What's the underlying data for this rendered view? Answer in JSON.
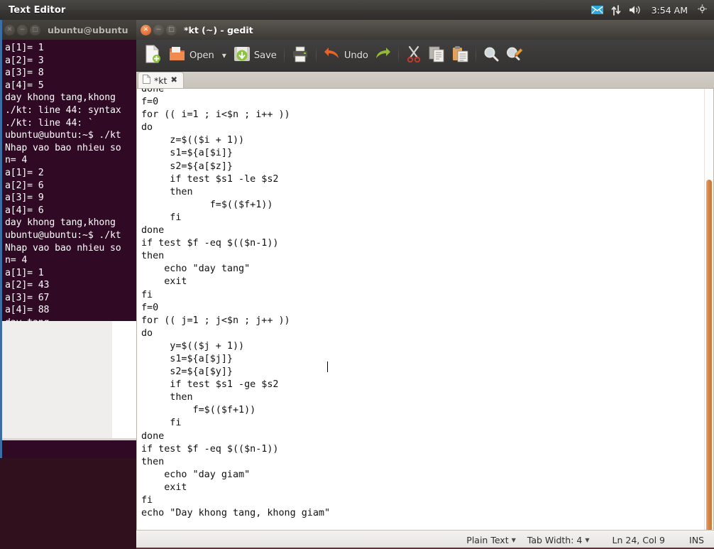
{
  "panel": {
    "title": "Text Editor",
    "clock": "3:54 AM",
    "icons": [
      "mail-icon",
      "network-icon",
      "volume-icon",
      "session-cog-icon"
    ]
  },
  "terminal_window": {
    "title": "ubuntu@ubuntu",
    "buttons": [
      "close",
      "minimize",
      "maximize"
    ],
    "content": "a[1]= 1\na[2]= 3\na[3]= 8\na[4]= 5\nday khong tang,khong\n./kt: line 44: syntax\n./kt: line 44: `\nubuntu@ubuntu:~$ ./kt\nNhap vao bao nhieu so\nn= 4\na[1]= 2\na[2]= 6\na[3]= 9\na[4]= 6\nday khong tang,khong\nubuntu@ubuntu:~$ ./kt\nNhap vao bao nhieu so\nn= 4\na[1]= 1\na[2]= 43\na[3]= 67\na[4]= 88\nday tang\nubuntu@ubuntu:~$ "
  },
  "gedit": {
    "title": "*kt (~) - gedit",
    "buttons": [
      "close",
      "minimize",
      "maximize"
    ],
    "toolbar": [
      {
        "name": "new-document-button",
        "label": "",
        "icon": "new-file-icon"
      },
      {
        "name": "open-button",
        "label": "Open",
        "icon": "open-folder-icon"
      },
      {
        "name": "open-dropdown-button",
        "label": "",
        "icon": "chevron-down-icon"
      },
      {
        "name": "save-button",
        "label": "Save",
        "icon": "save-disk-icon"
      },
      {
        "name": "print-button",
        "label": "",
        "icon": "printer-icon"
      },
      {
        "name": "undo-button",
        "label": "Undo",
        "icon": "undo-arrow-icon"
      },
      {
        "name": "redo-button",
        "label": "",
        "icon": "redo-arrow-icon"
      },
      {
        "name": "cut-button",
        "label": "",
        "icon": "scissors-icon"
      },
      {
        "name": "copy-button",
        "label": "",
        "icon": "copy-icon"
      },
      {
        "name": "paste-button",
        "label": "",
        "icon": "clipboard-paste-icon"
      },
      {
        "name": "find-button",
        "label": "",
        "icon": "magnifier-icon"
      },
      {
        "name": "replace-button",
        "label": "",
        "icon": "find-replace-icon"
      }
    ],
    "tab": {
      "label": "*kt",
      "close": "✖",
      "icon": "document-icon"
    },
    "code": "done\nf=0\nfor (( i=1 ; i<$n ; i++ ))\ndo\n     z=$(($i + 1))\n     s1=${a[$i]}\n     s2=${a[$z]}\n     if test $s1 -le $s2\n     then\n            f=$(($f+1))\n     fi\ndone\nif test $f -eq $(($n-1))\nthen\n    echo \"day tang\"\n    exit\nfi\nf=0\nfor (( j=1 ; j<$n ; j++ ))\ndo\n     y=$(($j + 1))\n     s1=${a[$j]}\n     s2=${a[$y]}\n     if test $s1 -ge $s2\n     then\n         f=$(($f+1))\n     fi\ndone\nif test $f -eq $(($n-1))\nthen\n    echo \"day giam\"\n    exit\nfi\necho \"Day khong tang, khong giam\"",
    "statusbar": {
      "language": "Plain Text",
      "tab_width": "Tab Width: 4",
      "position": "Ln 24, Col 9",
      "mode": "INS"
    }
  },
  "colors": {
    "terminal_bg": "#300a24",
    "panel_bg": "#3c3a37",
    "scrollbar": "#d5813f",
    "desktop": "#30101c"
  }
}
